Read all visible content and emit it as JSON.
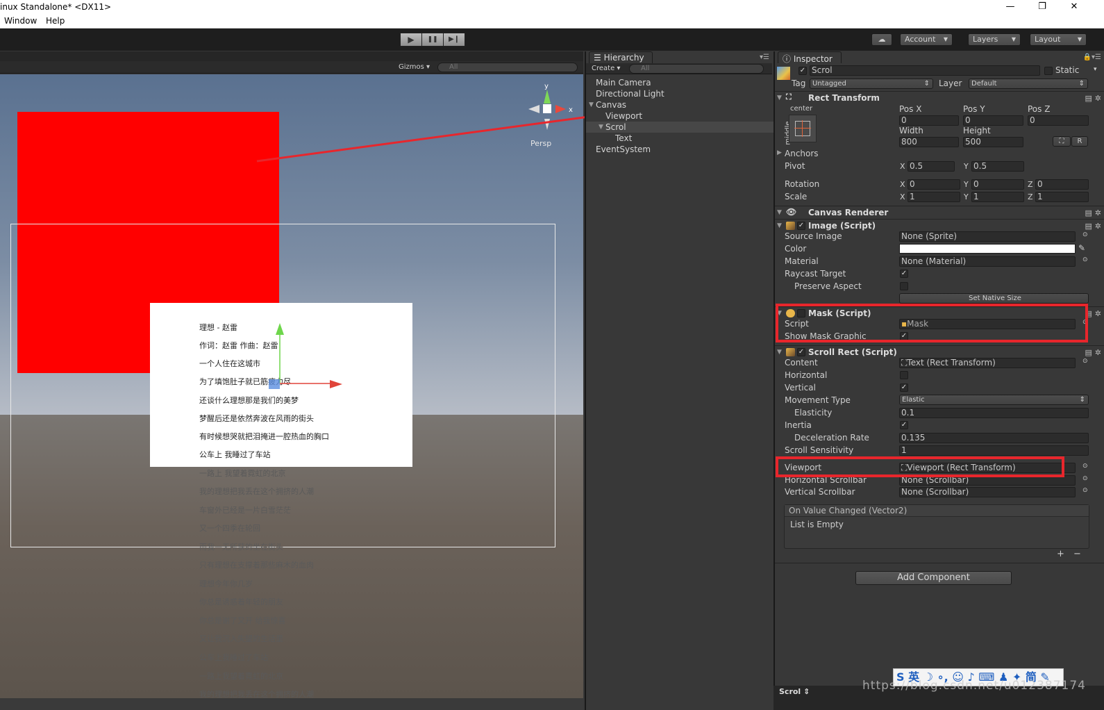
{
  "window": {
    "title": "inux Standalone* <DX11>",
    "minimize": "—",
    "maximize": "❐",
    "close": "✕"
  },
  "menu": {
    "window": "Window",
    "help": "Help"
  },
  "toolbar": {
    "play": "▶",
    "pause": "❚❚",
    "step": "▶❙",
    "cloud": "☁",
    "account": "Account",
    "layers": "Layers",
    "layout": "Layout"
  },
  "scene": {
    "gizmos": "Gizmos",
    "search_placeholder": "All",
    "persp": "Persp",
    "axis_y": "y",
    "axis_x": "x",
    "lyrics_visible": [
      "理想 - 赵雷",
      "作词：赵雷 作曲：赵雷",
      "一个人住在这城市",
      "为了填饱肚子就已筋疲力尽",
      "还谈什么理想那是我们的美梦",
      "梦醒后还是依然奔波在风雨的街头",
      "有时候想哭就把泪掩进一腔热血的胸口",
      "公车上 我睡过了车站"
    ],
    "lyrics_overflow": [
      "一路上 我望着霓虹的北京",
      "我的理想把我丢在这个拥挤的人潮",
      "车窗外已经是一片白雪茫茫",
      "又一个四季在轮回",
      "而我一无所获的坐在街头",
      "只有理想在支撑着那些麻木的血肉",
      "理想今年你几岁",
      "你总是诱惑着年轻的朋友",
      "你总是谢了又开 给我惊喜",
      "又让我沉入失望的生活里",
      "公车上我睡过了车站",
      "一路上我望着霓虹的北京",
      "我的理想把我丢在这个拥挤的人潮"
    ]
  },
  "hierarchy": {
    "tab": "Hierarchy",
    "create": "Create",
    "search_placeholder": "All",
    "items": [
      "Main Camera",
      "Directional Light",
      "Canvas",
      "Viewport",
      "Scrol",
      "Text",
      "EventSystem"
    ]
  },
  "inspector": {
    "tab": "Inspector",
    "object_name": "Scrol",
    "static": "Static",
    "tag_label": "Tag",
    "tag_value": "Untagged",
    "layer_label": "Layer",
    "layer_value": "Default",
    "rect_transform": {
      "title": "Rect Transform",
      "anchor_h": "center",
      "anchor_v": "middle",
      "posx_label": "Pos X",
      "posy_label": "Pos Y",
      "posz_label": "Pos Z",
      "posx": "0",
      "posy": "0",
      "posz": "0",
      "width_label": "Width",
      "height_label": "Height",
      "width": "800",
      "height": "500",
      "r_btn": "R",
      "anchors": "Anchors",
      "pivot": "Pivot",
      "pivot_x": "0.5",
      "pivot_y": "0.5",
      "rotation": "Rotation",
      "rot_x": "0",
      "rot_y": "0",
      "rot_z": "0",
      "scale": "Scale",
      "scale_x": "1",
      "scale_y": "1",
      "scale_z": "1",
      "x": "X",
      "y": "Y",
      "z": "Z"
    },
    "canvas_renderer": {
      "title": "Canvas Renderer"
    },
    "image": {
      "title": "Image (Script)",
      "source_image_label": "Source Image",
      "source_image": "None (Sprite)",
      "color_label": "Color",
      "material_label": "Material",
      "material": "None (Material)",
      "raycast_label": "Raycast Target",
      "preserve_label": "Preserve Aspect",
      "native_size": "Set Native Size"
    },
    "mask": {
      "title": "Mask (Script)",
      "script_label": "Script",
      "script_value": "Mask",
      "show_graphic_label": "Show Mask Graphic"
    },
    "scroll_rect": {
      "title": "Scroll Rect (Script)",
      "content_label": "Content",
      "content_value": "Text (Rect Transform)",
      "horizontal_label": "Horizontal",
      "vertical_label": "Vertical",
      "movement_label": "Movement Type",
      "movement_value": "Elastic",
      "elasticity_label": "Elasticity",
      "elasticity": "0.1",
      "inertia_label": "Inertia",
      "decel_label": "Deceleration Rate",
      "decel": "0.135",
      "sensitivity_label": "Scroll Sensitivity",
      "sensitivity": "1",
      "viewport_label": "Viewport",
      "viewport_value": "Viewport (Rect Transform)",
      "hscroll_label": "Horizontal Scrollbar",
      "hscroll_value": "None (Scrollbar)",
      "vscroll_label": "Vertical Scrollbar",
      "vscroll_value": "None (Scrollbar)",
      "event_title": "On Value Changed (Vector2)",
      "event_empty": "List is Empty",
      "plus": "+",
      "minus": "−"
    },
    "add_component": "Add Component",
    "footer": "Scrol"
  },
  "overlay": {
    "ime": "S 英 ☽ ∘, ☺ ♪ ⌨ ♟ ✦ 简 ✎",
    "watermark": "https://blog.csdn.net/u012387174"
  },
  "colors": {
    "highlight": "#e8262c",
    "red_quad": "#ff0000"
  }
}
